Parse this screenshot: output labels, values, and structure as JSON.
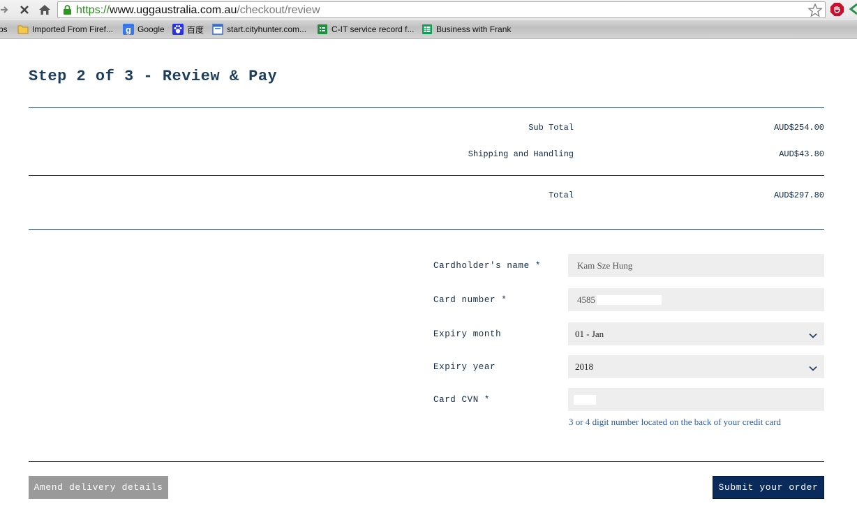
{
  "browser": {
    "url_scheme": "https://",
    "url_host": "www.uggaustralia.com.au",
    "url_path": "/checkout/review",
    "bookmarks": [
      {
        "label": "ps",
        "icon": "apps-icon"
      },
      {
        "label": "Imported From Firef...",
        "icon": "folder-icon"
      },
      {
        "label": "Google",
        "icon": "google-icon"
      },
      {
        "label": "百度",
        "icon": "baidu-icon"
      },
      {
        "label": "start.cityhunter.com...",
        "icon": "page-icon"
      },
      {
        "label": "C-IT service record f...",
        "icon": "forms-icon"
      },
      {
        "label": "Business with Frank",
        "icon": "sheets-icon"
      }
    ]
  },
  "page": {
    "title": "Step 2 of 3 - Review & Pay",
    "summary": {
      "subtotal_label": "Sub Total",
      "subtotal_value": "AUD$254.00",
      "shipping_label": "Shipping and Handling",
      "shipping_value": "AUD$43.80",
      "total_label": "Total",
      "total_value": "AUD$297.80"
    },
    "payment": {
      "cardholder_label": "Cardholder's name *",
      "cardholder_value": "Kam Sze Hung",
      "card_number_label": "Card number *",
      "card_number_value": "4585",
      "expiry_month_label": "Expiry month",
      "expiry_month_value": "01 - Jan",
      "expiry_year_label": "Expiry year",
      "expiry_year_value": "2018",
      "cvn_label": "Card CVN *",
      "cvn_hint": "3 or 4 digit number located on the back of your credit card"
    },
    "actions": {
      "amend_label": "Amend delivery details",
      "submit_label": "Submit your order"
    }
  },
  "colors": {
    "navy": "#0a2a5c",
    "text_navy": "#0f2a4a",
    "field_bg": "#eeeeee",
    "hint_blue": "#2b59b0",
    "button_grey": "#9a9a9a"
  }
}
